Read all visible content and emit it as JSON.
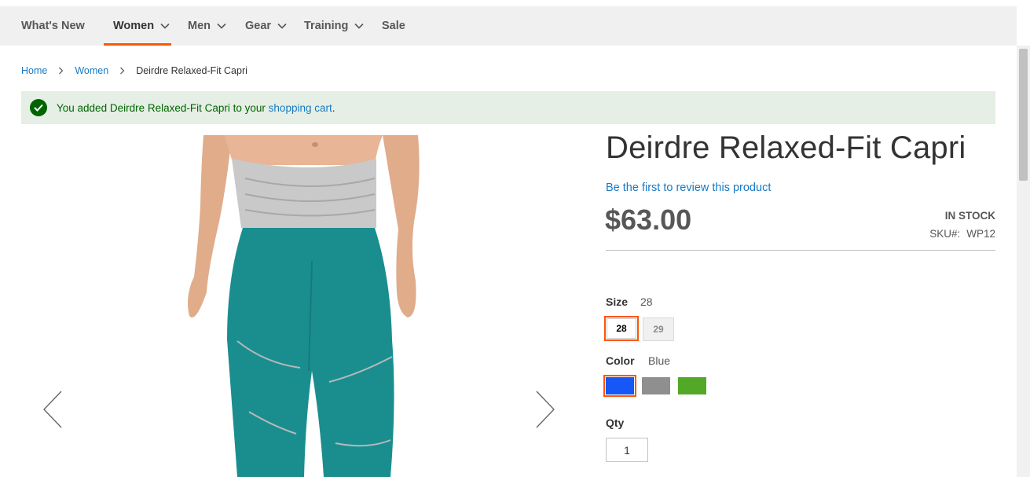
{
  "nav": {
    "items": [
      {
        "label": "What's New",
        "has_dropdown": false,
        "active": false
      },
      {
        "label": "Women",
        "has_dropdown": true,
        "active": true
      },
      {
        "label": "Men",
        "has_dropdown": true,
        "active": false
      },
      {
        "label": "Gear",
        "has_dropdown": true,
        "active": false
      },
      {
        "label": "Training",
        "has_dropdown": true,
        "active": false
      },
      {
        "label": "Sale",
        "has_dropdown": false,
        "active": false
      }
    ],
    "accent_color": "#ff5501"
  },
  "breadcrumb": {
    "home": "Home",
    "category": "Women",
    "current": "Deirdre Relaxed-Fit Capri"
  },
  "message": {
    "prefix": "You added Deirdre Relaxed-Fit Capri to your",
    "link": "shopping cart",
    "suffix": "."
  },
  "product": {
    "title": "Deirdre Relaxed-Fit Capri",
    "review_link": "Be the first to review this product",
    "price": "$63.00",
    "stock": "In stock",
    "sku_label": "SKU#:",
    "sku": "WP12"
  },
  "options": {
    "size": {
      "label": "Size",
      "selected": "28",
      "values": [
        "28",
        "29"
      ]
    },
    "color": {
      "label": "Color",
      "selected": "Blue",
      "swatches": [
        {
          "name": "Blue",
          "hex": "#1857f7"
        },
        {
          "name": "Gray",
          "hex": "#8f8f8f"
        },
        {
          "name": "Green",
          "hex": "#53a828"
        }
      ]
    }
  },
  "qty": {
    "label": "Qty",
    "value": "1"
  }
}
